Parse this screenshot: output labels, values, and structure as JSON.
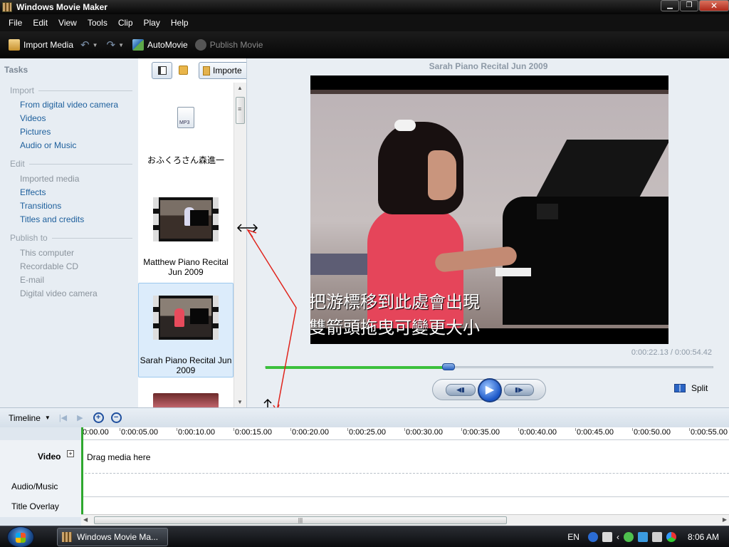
{
  "window": {
    "title": "Windows Movie Maker"
  },
  "menu": [
    "File",
    "Edit",
    "View",
    "Tools",
    "Clip",
    "Play",
    "Help"
  ],
  "toolbar": {
    "import_media": "Import Media",
    "automovie": "AutoMovie",
    "publish_movie": "Publish Movie"
  },
  "tasks": {
    "header": "Tasks",
    "sections": [
      {
        "title": "Import",
        "items": [
          {
            "label": "From digital video camera",
            "enabled": true
          },
          {
            "label": "Videos",
            "enabled": true
          },
          {
            "label": "Pictures",
            "enabled": true
          },
          {
            "label": "Audio or Music",
            "enabled": true
          }
        ]
      },
      {
        "title": "Edit",
        "items": [
          {
            "label": "Imported media",
            "enabled": false
          },
          {
            "label": "Effects",
            "enabled": true
          },
          {
            "label": "Transitions",
            "enabled": true
          },
          {
            "label": "Titles and credits",
            "enabled": true
          }
        ]
      },
      {
        "title": "Publish to",
        "items": [
          {
            "label": "This computer",
            "enabled": false
          },
          {
            "label": "Recordable CD",
            "enabled": false
          },
          {
            "label": "E-mail",
            "enabled": false
          },
          {
            "label": "Digital video camera",
            "enabled": false
          }
        ]
      }
    ]
  },
  "collection": {
    "dropdown_label": "Importe",
    "items": [
      {
        "icon": "mp3-file-icon",
        "icon_text": "MP3",
        "caption": "おふくろさん森進一"
      },
      {
        "icon": "video-thumbnail",
        "caption_line1": "Matthew Piano Recital",
        "caption_line2": "Jun 2009"
      },
      {
        "icon": "video-thumbnail",
        "caption_line1": "Sarah Piano Recital Jun",
        "caption_line2": "2009",
        "selected": true
      }
    ]
  },
  "preview": {
    "title": "Sarah Piano Recital Jun 2009",
    "caption_line1": "把游標移到此處會出現",
    "caption_line2": "雙箭頭拖曳可變更大小",
    "time_current": "0:00:22.13",
    "time_total": "0:00:54.42",
    "time_separator": " / ",
    "progress": 0.41,
    "split_label": "Split"
  },
  "timeline": {
    "mode_label": "Timeline",
    "ruler": [
      "0:00.00",
      "0:00:05.00",
      "0:00:10.00",
      "0:00:15.00",
      "0:00:20.00",
      "0:00:25.00",
      "0:00:30.00",
      "0:00:35.00",
      "0:00:40.00",
      "0:00:45.00",
      "0:00:50.00",
      "0:00:55.00"
    ],
    "tracks": {
      "video": "Video",
      "audio": "Audio/Music",
      "title": "Title Overlay"
    },
    "drag_hint": "Drag media here"
  },
  "taskbar": {
    "window_button": "Windows Movie Ma...",
    "language": "EN",
    "clock": "8:06 AM"
  },
  "colors": {
    "annotation": "#e0241c",
    "accent": "#1d5f9c",
    "progress": "#3cc03c"
  }
}
